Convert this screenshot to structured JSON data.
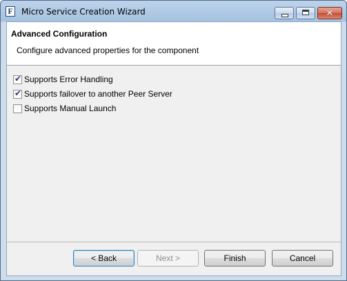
{
  "window": {
    "title": "Micro Service Creation Wizard",
    "app_icon_letter": "F"
  },
  "header": {
    "title": "Advanced Configuration",
    "description": "Configure advanced properties for the component"
  },
  "options": [
    {
      "label": "Supports Error Handling",
      "checked": true
    },
    {
      "label": "Supports failover to another Peer Server",
      "checked": true
    },
    {
      "label": "Supports Manual Launch",
      "checked": false
    }
  ],
  "buttons": {
    "back": "< Back",
    "next": "Next >",
    "finish": "Finish",
    "cancel": "Cancel"
  },
  "glyphs": {
    "check": "✔",
    "close": "✕"
  }
}
